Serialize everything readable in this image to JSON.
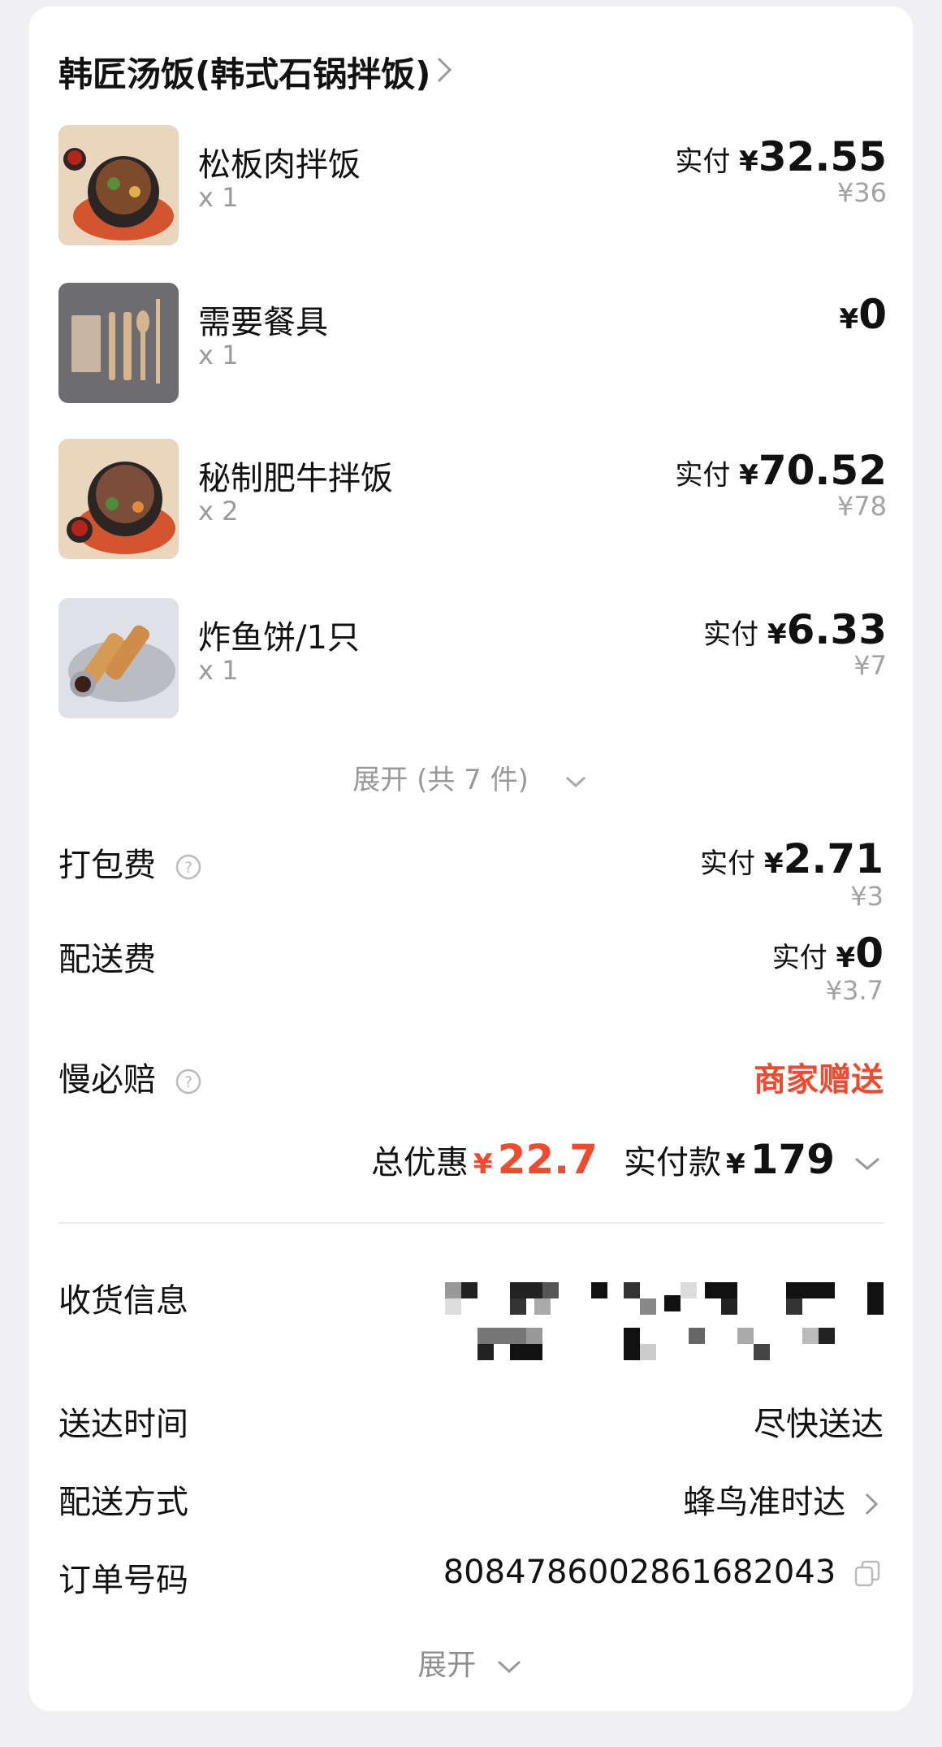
{
  "shop": {
    "name": "韩匠汤饭(韩式石锅拌饭)"
  },
  "items": [
    {
      "name": "松板肉拌饭",
      "qty": "x 1",
      "paid_label": "实付",
      "currency": "¥",
      "paid": "32.55",
      "original": "¥36"
    },
    {
      "name": "需要餐具",
      "qty": "x 1",
      "paid_label": "",
      "currency": "¥",
      "paid": "0",
      "original": ""
    },
    {
      "name": "秘制肥牛拌饭",
      "qty": "x 2",
      "paid_label": "实付",
      "currency": "¥",
      "paid": "70.52",
      "original": "¥78"
    },
    {
      "name": "炸鱼饼/1只",
      "qty": "x 1",
      "paid_label": "实付",
      "currency": "¥",
      "paid": "6.33",
      "original": "¥7"
    }
  ],
  "expand_items_label": "展开 (共 7 件)",
  "fees": {
    "packing": {
      "label": "打包费",
      "paid_label": "实付",
      "currency": "¥",
      "paid": "2.71",
      "original": "¥3"
    },
    "delivery": {
      "label": "配送费",
      "paid_label": "实付",
      "currency": "¥",
      "paid": "0",
      "original": "¥3.7"
    },
    "late_comp": {
      "label": "慢必赔",
      "value": "商家赠送"
    }
  },
  "summary": {
    "discount_label": "总优惠",
    "currency": "¥",
    "discount": "22.7",
    "paid_label": "实付款",
    "paid": "179"
  },
  "info": {
    "receiver_label": "收货信息",
    "time_label": "送达时间",
    "time_value": "尽快送达",
    "method_label": "配送方式",
    "method_value": "蜂鸟准时达",
    "order_label": "订单号码",
    "order_value": "8084786002861682043"
  },
  "expand_bottom_label": "展开",
  "colors": {
    "accent_red": "#f04a30",
    "muted": "#9a9a9a",
    "card": "#ffffff",
    "background": "#f0f0f2"
  }
}
